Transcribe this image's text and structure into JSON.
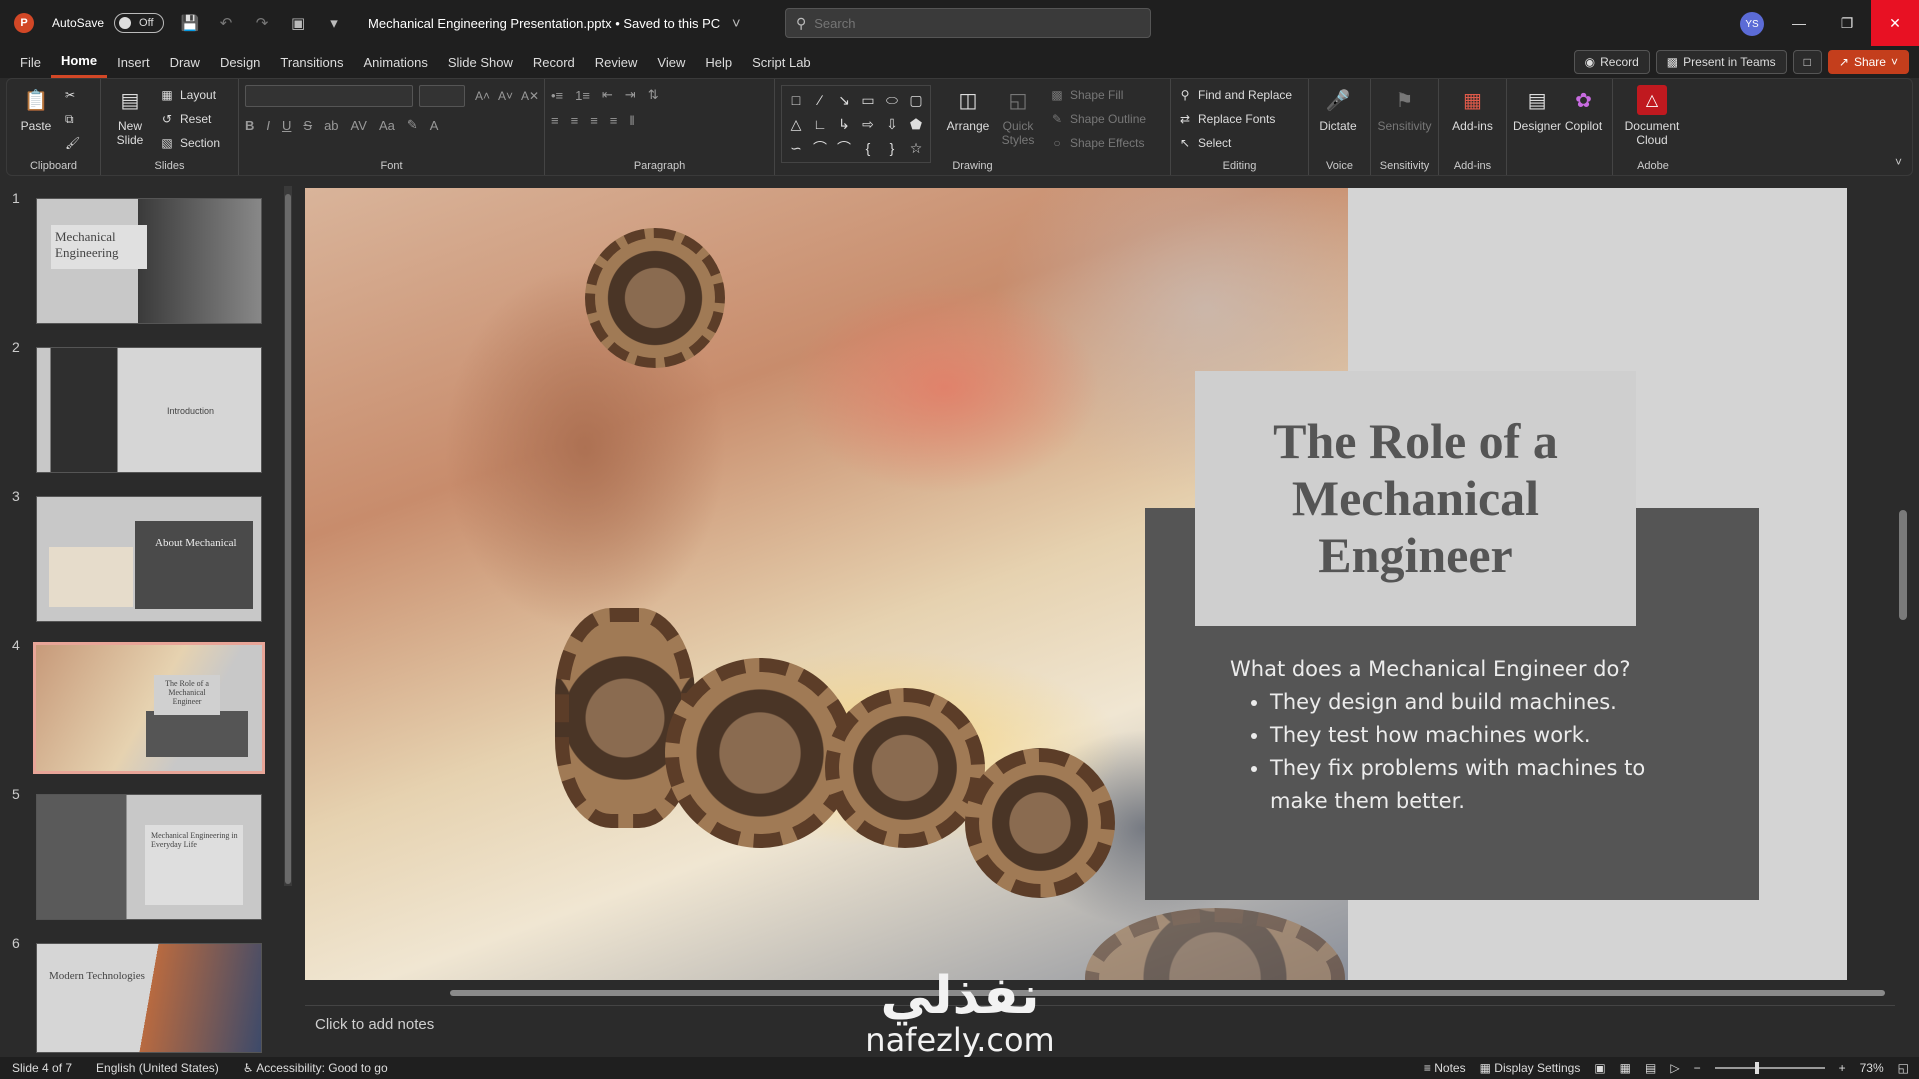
{
  "titlebar": {
    "autosave_label": "AutoSave",
    "autosave_state": "Off",
    "document_title": "Mechanical Engineering Presentation.pptx • Saved to this PC",
    "search_placeholder": "Search",
    "avatar_initials": "YS"
  },
  "menu": {
    "tabs": [
      "File",
      "Home",
      "Insert",
      "Draw",
      "Design",
      "Transitions",
      "Animations",
      "Slide Show",
      "Record",
      "Review",
      "View",
      "Help",
      "Script Lab"
    ],
    "active_tab": "Home",
    "record_btn": "Record",
    "present_btn": "Present in Teams",
    "share_btn": "Share"
  },
  "ribbon": {
    "clipboard": {
      "paste": "Paste",
      "label": "Clipboard"
    },
    "slides": {
      "new_slide": "New Slide",
      "layout": "Layout",
      "reset": "Reset",
      "section": "Section",
      "label": "Slides"
    },
    "font": {
      "label": "Font"
    },
    "paragraph": {
      "label": "Paragraph"
    },
    "drawing": {
      "arrange": "Arrange",
      "quick_styles": "Quick Styles",
      "shape_fill": "Shape Fill",
      "shape_outline": "Shape Outline",
      "shape_effects": "Shape Effects",
      "label": "Drawing"
    },
    "editing": {
      "find_replace": "Find and Replace",
      "replace_fonts": "Replace Fonts",
      "select": "Select",
      "label": "Editing"
    },
    "voice": {
      "dictate": "Dictate",
      "label": "Voice"
    },
    "sensitivity": {
      "btn": "Sensitivity",
      "label": "Sensitivity"
    },
    "addins": {
      "btn": "Add-ins",
      "label": "Add-ins"
    },
    "designer": "Designer",
    "copilot": "Copilot",
    "adobe": {
      "btn": "Document Cloud",
      "label": "Adobe"
    }
  },
  "thumbnails": [
    {
      "num": "1",
      "title": "Mechanical Engineering"
    },
    {
      "num": "2",
      "title": "Introduction"
    },
    {
      "num": "3",
      "title": "About Mechanical"
    },
    {
      "num": "4",
      "title": "The Role of a Mechanical Engineer"
    },
    {
      "num": "5",
      "title": "Mechanical Engineering in Everyday Life"
    },
    {
      "num": "6",
      "title": "Modern Technologies"
    }
  ],
  "slide": {
    "title": "The Role of a Mechanical Engineer",
    "question": "What does a Mechanical Engineer do?",
    "bullets": [
      "They design and build machines.",
      "They test how machines work.",
      "They fix problems with machines to make them better."
    ]
  },
  "notes_placeholder": "Click to add notes",
  "status": {
    "slide_info": "Slide 4 of 7",
    "language": "English (United States)",
    "accessibility": "Accessibility: Good to go",
    "notes": "Notes",
    "display_settings": "Display Settings",
    "zoom": "73%"
  },
  "watermark": {
    "arabic": "نفذلي",
    "latin": "nafezly.com"
  },
  "colors": {
    "accent": "#d24726",
    "share": "#c43e1c",
    "close": "#e81123",
    "panel": "#555555"
  }
}
